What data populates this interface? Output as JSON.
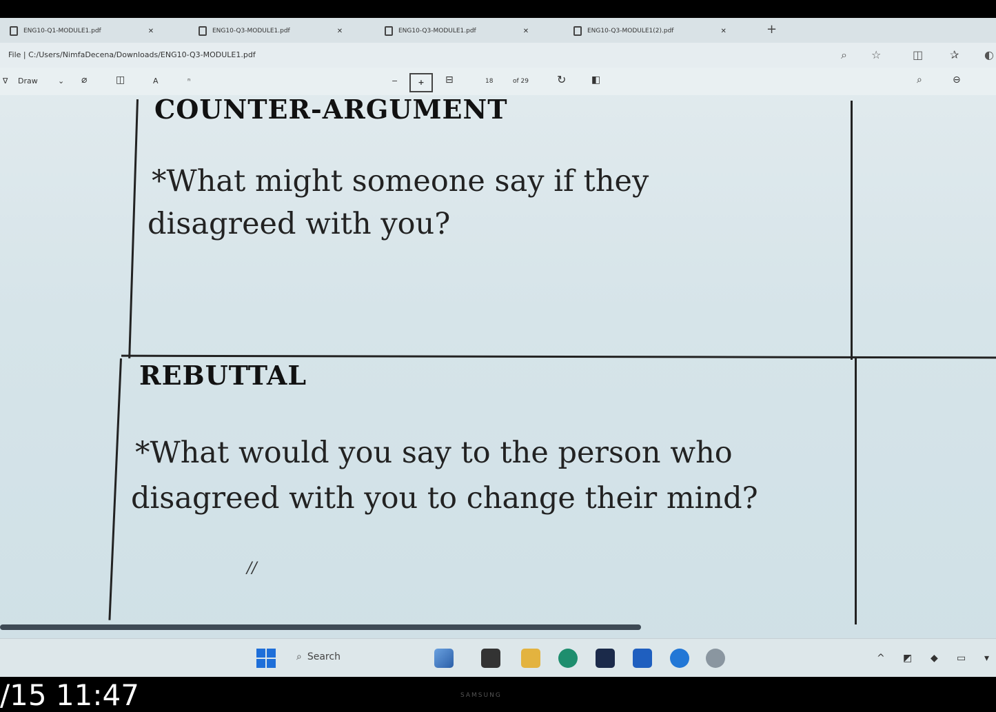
{
  "browser": {
    "tabs": [
      {
        "label": "ENG10-Q1-MODULE1.pdf"
      },
      {
        "label": "ENG10-Q3-MODULE1.pdf"
      },
      {
        "label": "ENG10-Q3-MODULE1.pdf"
      },
      {
        "label": "ENG10-Q3-MODULE1(2).pdf"
      }
    ],
    "new_tab": "+",
    "address": "File  |  C:/Users/NimfaDecena/Downloads/ENG10-Q3-MODULE1.pdf"
  },
  "pdf_toolbar": {
    "draw_label": "Draw",
    "text_size": "A",
    "page_current": "18",
    "page_total": "of 29"
  },
  "document": {
    "sections": [
      {
        "heading": "COUNTER-ARGUMENT",
        "question_line1": "*What might someone say if they",
        "question_line2": "disagreed with you?"
      },
      {
        "heading": "REBUTTAL",
        "question_line1": "*What would you say to the person who",
        "question_line2": "disagreed with you to change their mind?"
      }
    ],
    "hand_mark": "//"
  },
  "taskbar": {
    "search_label": "Search"
  },
  "overlay": {
    "timestamp": "/15 11:47",
    "brand": "SAMSUNG"
  }
}
